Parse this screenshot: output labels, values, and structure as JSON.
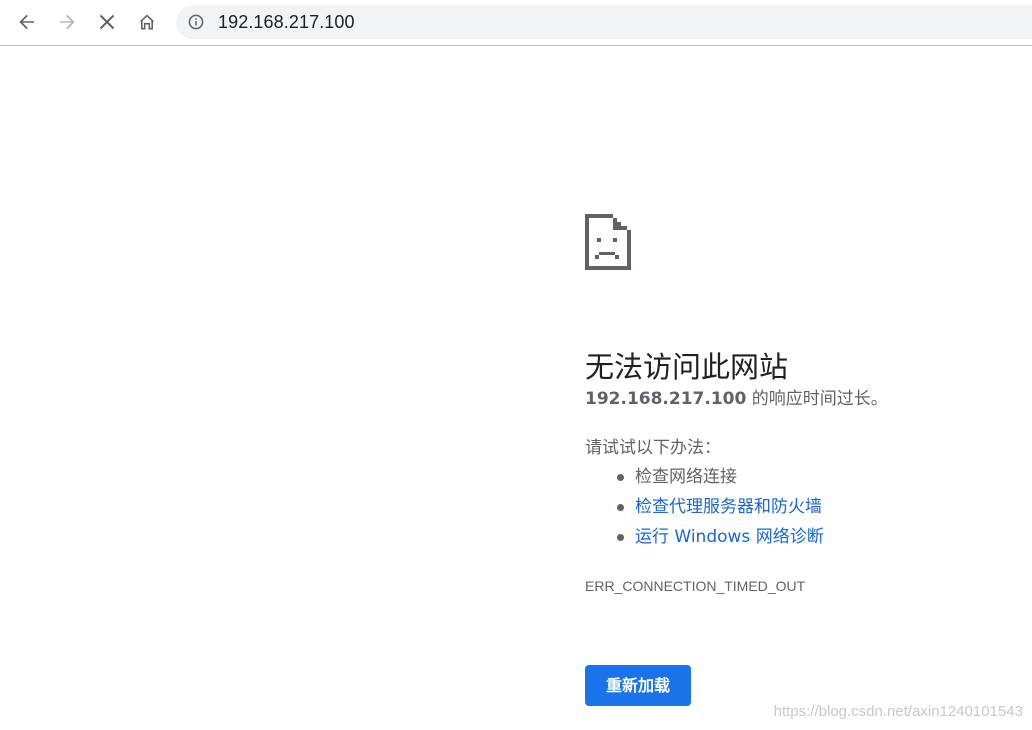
{
  "toolbar": {
    "back_icon": "arrow-left-icon",
    "forward_icon": "arrow-right-icon",
    "stop_icon": "close-icon",
    "home_icon": "home-icon",
    "url": "192.168.217.100",
    "info_icon": "info-circle-icon"
  },
  "error_page": {
    "icon": "sad-document-icon",
    "title": "无法访问此网站",
    "host": "192.168.217.100",
    "description_suffix": " 的响应时间过长。",
    "suggestions_heading": "请试试以下办法：",
    "suggestions": [
      {
        "label": "检查网络连接",
        "is_link": false
      },
      {
        "label": "检查代理服务器和防火墙",
        "is_link": true
      },
      {
        "label": "运行 Windows 网络诊断",
        "is_link": true
      }
    ],
    "error_code": "ERR_CONNECTION_TIMED_OUT",
    "reload_label": "重新加载"
  },
  "watermark": "https://blog.csdn.net/axin1240101543",
  "colors": {
    "accent": "#1a73e8",
    "link": "#1967d2",
    "text_secondary": "#5f6368",
    "text_primary": "#202124",
    "omnibox_bg": "#f1f3f4"
  }
}
